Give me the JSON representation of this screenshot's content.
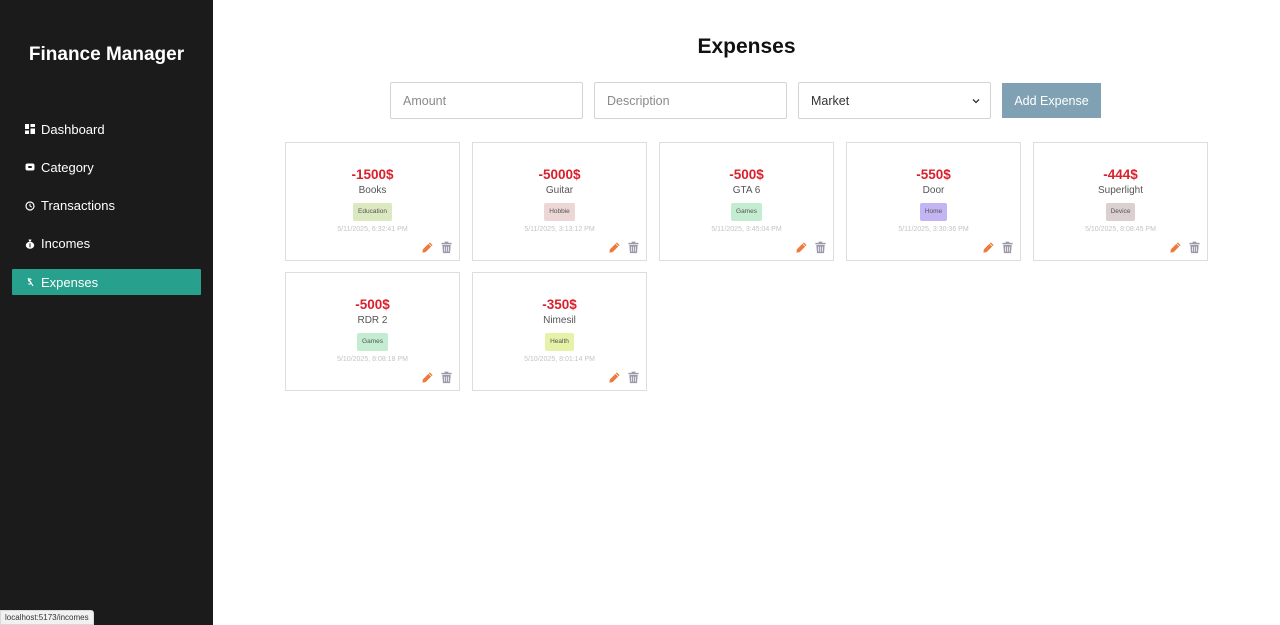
{
  "app": {
    "title": "Finance Manager"
  },
  "sidebar": {
    "items": [
      {
        "label": "Dashboard",
        "icon": "dashboard-icon",
        "active": false
      },
      {
        "label": "Category",
        "icon": "category-icon",
        "active": false
      },
      {
        "label": "Transactions",
        "icon": "history-icon",
        "active": false
      },
      {
        "label": "Incomes",
        "icon": "money-bag-icon",
        "active": false
      },
      {
        "label": "Expenses",
        "icon": "expense-icon",
        "active": true
      }
    ]
  },
  "status_bar": {
    "url": "localhost:5173/incomes"
  },
  "page": {
    "title": "Expenses"
  },
  "form": {
    "amount_placeholder": "Amount",
    "description_placeholder": "Description",
    "category_selected": "Market",
    "add_button": "Add Expense"
  },
  "expenses": [
    {
      "amount": "-1500$",
      "description": "Books",
      "category": "Education",
      "badge_color": "#dce8c0",
      "date": "5/11/2025, 6:32:41 PM"
    },
    {
      "amount": "-5000$",
      "description": "Guitar",
      "category": "Hobbie",
      "badge_color": "#ecd6d6",
      "date": "5/11/2025, 3:13:12 PM"
    },
    {
      "amount": "-500$",
      "description": "GTA 6",
      "category": "Games",
      "badge_color": "#c4ecd1",
      "date": "5/11/2025, 3:45:04 PM"
    },
    {
      "amount": "-550$",
      "description": "Door",
      "category": "Home",
      "badge_color": "#c3b5f3",
      "date": "5/11/2025, 3:30:36 PM"
    },
    {
      "amount": "-444$",
      "description": "Superlight",
      "category": "Device",
      "badge_color": "#dbcfcf",
      "date": "5/10/2025, 8:08:45 PM"
    },
    {
      "amount": "-500$",
      "description": "RDR 2",
      "category": "Games",
      "badge_color": "#c4ecd1",
      "date": "5/10/2025, 8:08:18 PM"
    },
    {
      "amount": "-350$",
      "description": "Nimesil",
      "category": "Health",
      "badge_color": "#e6f2a8",
      "date": "5/10/2025, 8:01:14 PM"
    }
  ],
  "colors": {
    "sidebar_bg": "#1b1b1b",
    "active_nav": "#28a08e",
    "amount_red": "#d9202c",
    "add_button": "#7fa1b3",
    "edit_icon": "#ee7b3c",
    "delete_icon": "#9a9aaa"
  }
}
